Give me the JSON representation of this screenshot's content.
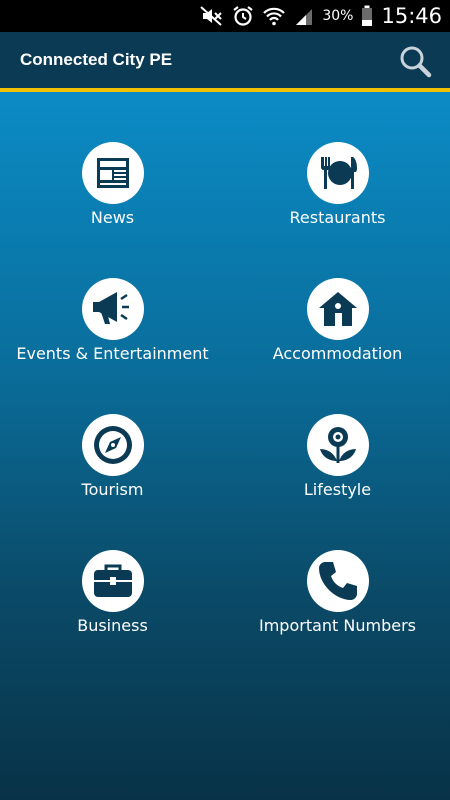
{
  "status_bar": {
    "battery_percent": "30%",
    "time": "15:46",
    "icons": [
      "mute-icon",
      "alarm-icon",
      "wifi-icon",
      "signal-icon",
      "battery-icon"
    ]
  },
  "app_bar": {
    "title": "Connected City PE",
    "search_icon": "search-icon"
  },
  "colors": {
    "app_bar": "#0b3b54",
    "accent_line": "#f2c200",
    "gradient_top": "#0b8bc5",
    "gradient_bottom": "#083247"
  },
  "categories": [
    {
      "label": "News",
      "icon": "newspaper-icon"
    },
    {
      "label": "Restaurants",
      "icon": "plate-cutlery-icon"
    },
    {
      "label": "Events & Entertainment",
      "icon": "megaphone-icon"
    },
    {
      "label": "Accommodation",
      "icon": "house-icon"
    },
    {
      "label": "Tourism",
      "icon": "compass-icon"
    },
    {
      "label": "Lifestyle",
      "icon": "flower-icon"
    },
    {
      "label": "Business",
      "icon": "briefcase-icon"
    },
    {
      "label": "Important Numbers",
      "icon": "phone-icon"
    }
  ]
}
